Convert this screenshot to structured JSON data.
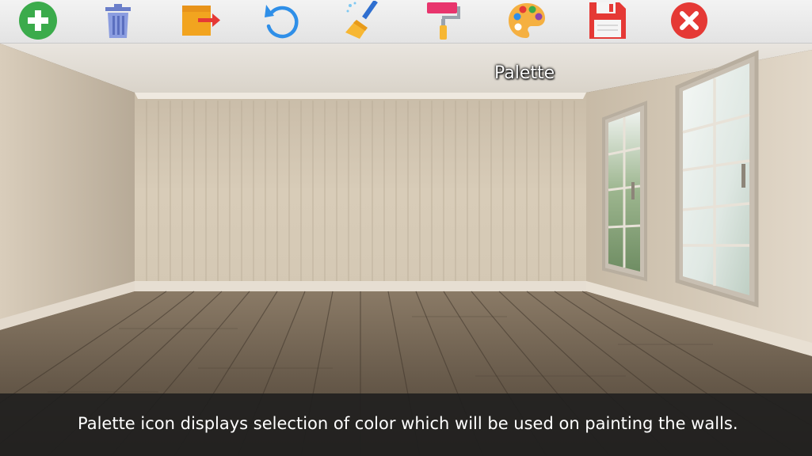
{
  "toolbar": {
    "tools": [
      {
        "icon": "add-icon",
        "color": "#3bab4b"
      },
      {
        "icon": "trash-icon",
        "color": "#7b8fd6"
      },
      {
        "icon": "export-icon",
        "color": "#f2a41f"
      },
      {
        "icon": "undo-icon",
        "color": "#2f8fe8"
      },
      {
        "icon": "broom-icon",
        "color": "#f7b733"
      },
      {
        "icon": "paint-roller-icon",
        "color": "#e8356d"
      },
      {
        "icon": "palette-icon",
        "color": "#f5b041"
      },
      {
        "icon": "save-icon",
        "color": "#e53935"
      },
      {
        "icon": "close-icon",
        "color": "#e53935"
      }
    ]
  },
  "tooltip": {
    "text": "Palette"
  },
  "caption": {
    "text": "Palette icon displays selection of color which will be used on painting the walls."
  }
}
